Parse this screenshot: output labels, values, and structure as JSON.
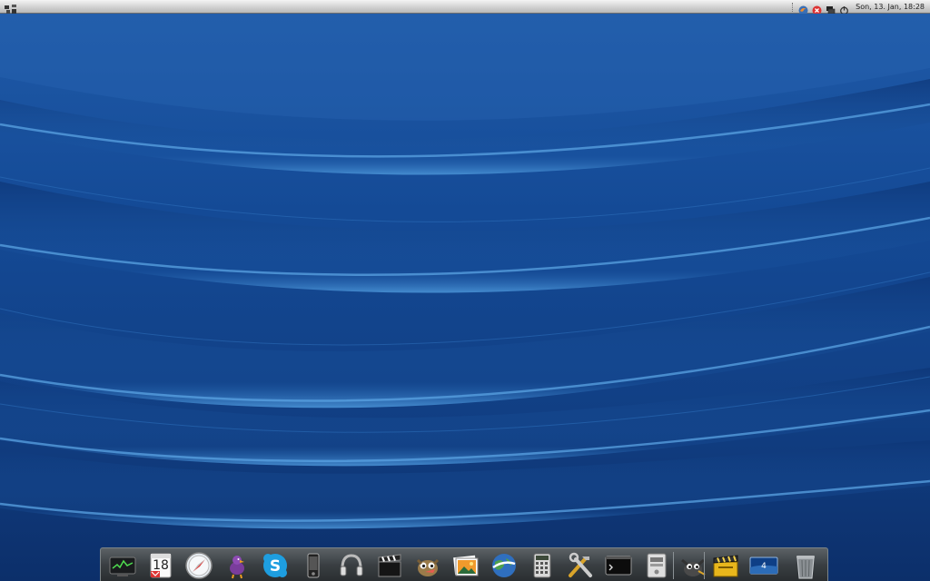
{
  "top_panel": {
    "clock": "Son, 13. Jan, 18:28",
    "tray_icons": [
      "network-icon",
      "firefox-icon",
      "close-icon",
      "display-icon",
      "power-icon"
    ]
  },
  "dock": {
    "items": [
      {
        "name": "system-monitor-icon"
      },
      {
        "name": "calendar-icon",
        "label": "18"
      },
      {
        "name": "safari-compass-icon"
      },
      {
        "name": "pidgin-bird-icon"
      },
      {
        "name": "skype-icon",
        "label": "S"
      },
      {
        "name": "phone-icon"
      },
      {
        "name": "headphones-icon"
      },
      {
        "name": "clapperboard-icon"
      },
      {
        "name": "gimp-icon"
      },
      {
        "name": "photos-icon"
      },
      {
        "name": "google-earth-icon"
      },
      {
        "name": "calculator-icon"
      },
      {
        "name": "tools-icon"
      },
      {
        "name": "terminal-icon"
      },
      {
        "name": "storage-icon"
      },
      {
        "name": "gimp-running-icon"
      },
      {
        "name": "video-editor-icon"
      },
      {
        "name": "workspace-switcher-icon",
        "label": "4"
      },
      {
        "name": "trash-icon"
      }
    ]
  },
  "colors": {
    "wallpaper_base": "#12418a",
    "wave_highlight": "#3c86cc",
    "panel": "#d8d8d8",
    "dock": "#3a3f43"
  }
}
